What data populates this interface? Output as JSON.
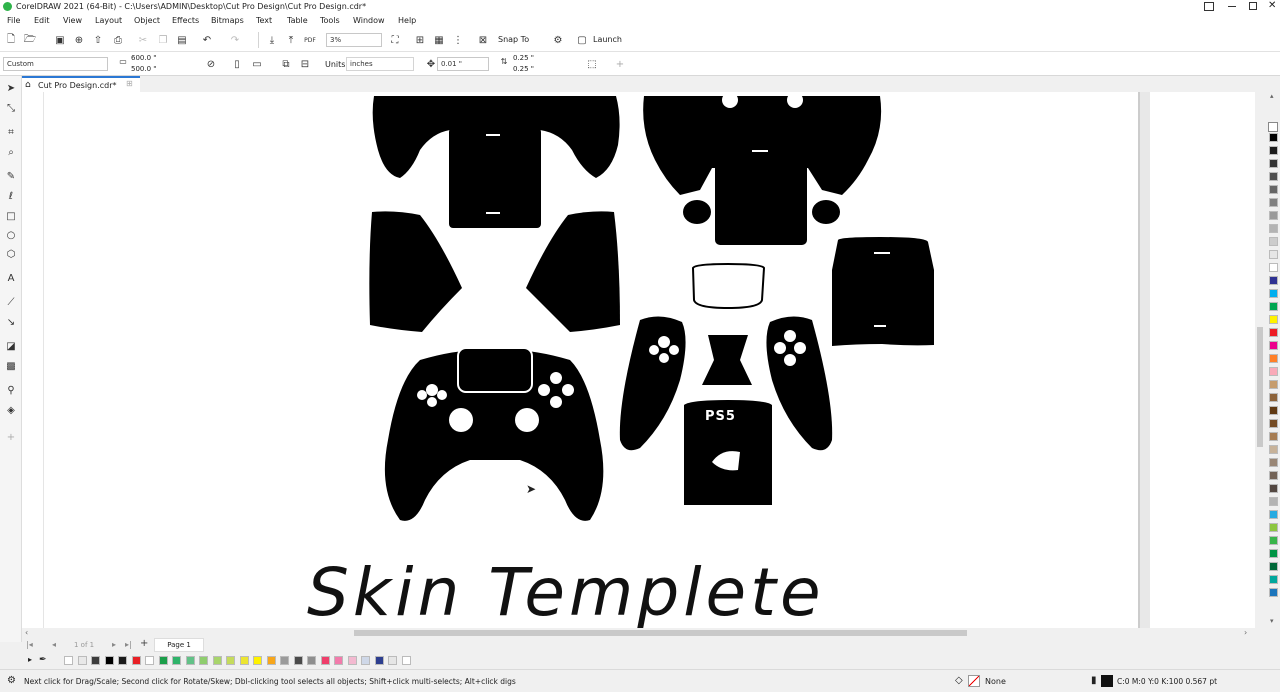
{
  "window": {
    "title": "CorelDRAW 2021 (64-Bit) - C:\\Users\\ADMIN\\Desktop\\Cut Pro Design\\Cut Pro Design.cdr*"
  },
  "menu": [
    "File",
    "Edit",
    "View",
    "Layout",
    "Object",
    "Effects",
    "Bitmaps",
    "Text",
    "Table",
    "Tools",
    "Window",
    "Help"
  ],
  "toolbar": {
    "zoom": "3%",
    "snap_to": "Snap To",
    "launch": "Launch"
  },
  "property_bar": {
    "preset": "Custom",
    "width": "600.0 \"",
    "height": "500.0 \"",
    "units_label": "Units:",
    "units_value": "inches",
    "nudge": "0.01 \"",
    "dup_x": "0.25 \"",
    "dup_y": "0.25 \""
  },
  "document": {
    "tab_name": "Cut Pro Design.cdr*",
    "heading": "Skin Templete",
    "logo_text": "PS5"
  },
  "page_nav": {
    "count": "1  of  1",
    "page_tab": "Page 1"
  },
  "status": {
    "hint": "Next click for Drag/Scale; Second click for Rotate/Skew; Dbl-clicking tool selects all objects; Shift+click multi-selects; Alt+click digs",
    "fill_label": "None",
    "outline_label": "C:0 M:0 Y:0 K:100  0.567 pt"
  },
  "colors": {
    "accent": "#2b78d4",
    "selection_blue": "#1e73d6"
  },
  "palette_bottom": [
    "#ffffff",
    "#e8e8e8",
    "#3c3c3c",
    "#000000",
    "#1a1a1a",
    "#e81f25",
    "#ffffff",
    "#1b9e4a",
    "#2fb36a",
    "#62c187",
    "#8fcd6e",
    "#a8d46b",
    "#c5db5c",
    "#ece531",
    "#fff200",
    "#f7a61b",
    "#9b9b9b",
    "#4a4a4a",
    "#8e8e8e",
    "#ef3e6b",
    "#f27bab",
    "#f3b9d0",
    "#cfd8e8",
    "#2d3e8f",
    "#e6e6e6",
    "#ffffff"
  ],
  "palette_right": [
    "#000000",
    "#1a1a1a",
    "#333333",
    "#4d4d4d",
    "#666666",
    "#808080",
    "#999999",
    "#b3b3b3",
    "#cccccc",
    "#e6e6e6",
    "#ffffff",
    "#2e3192",
    "#00aeef",
    "#00a651",
    "#fff200",
    "#ed1c24",
    "#ec008c",
    "#ff7f27",
    "#f9a9b8",
    "#c69c6d",
    "#8c6239",
    "#603913",
    "#754c24",
    "#a67c52",
    "#c7b299",
    "#998675",
    "#736357",
    "#534741",
    "#b3b3b3",
    "#27aae1",
    "#8dc63f",
    "#39b54a",
    "#009444",
    "#006838",
    "#00a79d",
    "#1c75bc"
  ]
}
